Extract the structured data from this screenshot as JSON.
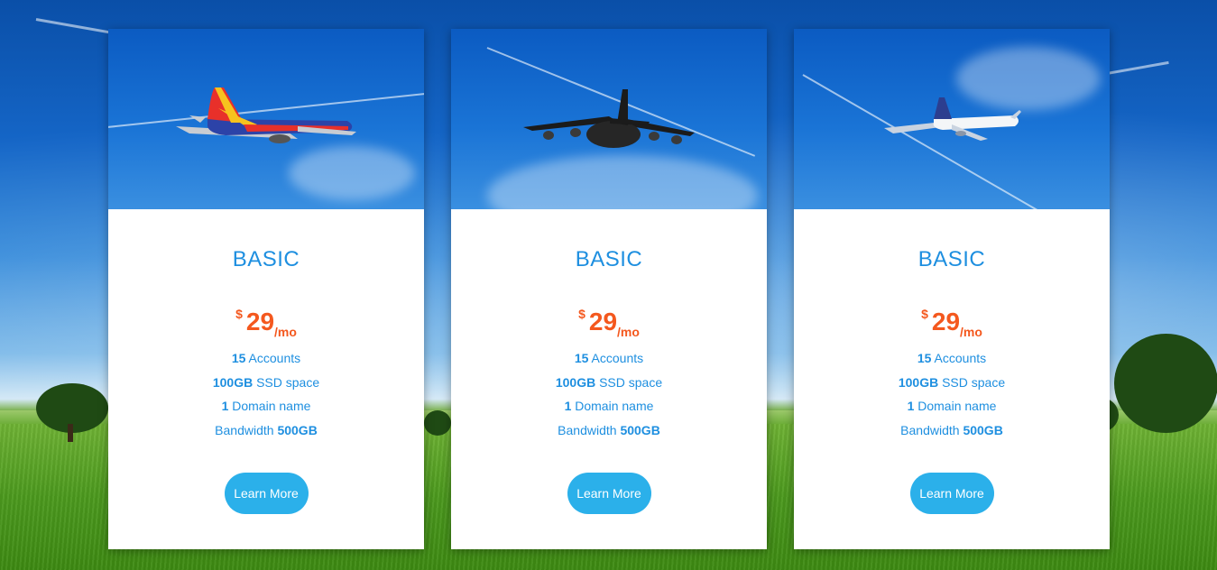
{
  "plans": [
    {
      "title": "BASIC",
      "price": {
        "currency": "$",
        "amount": "29",
        "period": "/mo"
      },
      "features": [
        {
          "strong": "15",
          "text": " Accounts",
          "order": "strong-first"
        },
        {
          "strong": "100GB",
          "text": " SSD space",
          "order": "strong-first"
        },
        {
          "strong": "1",
          "text": " Domain name",
          "order": "strong-first"
        },
        {
          "strong": "500GB",
          "text": "Bandwidth ",
          "order": "text-first"
        }
      ],
      "button": "Learn More",
      "image": "southwest-airliner-icon"
    },
    {
      "title": "BASIC",
      "price": {
        "currency": "$",
        "amount": "29",
        "period": "/mo"
      },
      "features": [
        {
          "strong": "15",
          "text": " Accounts",
          "order": "strong-first"
        },
        {
          "strong": "100GB",
          "text": " SSD space",
          "order": "strong-first"
        },
        {
          "strong": "1",
          "text": " Domain name",
          "order": "strong-first"
        },
        {
          "strong": "500GB",
          "text": "Bandwidth ",
          "order": "text-first"
        }
      ],
      "button": "Learn More",
      "image": "black-cargo-plane-icon"
    },
    {
      "title": "BASIC",
      "price": {
        "currency": "$",
        "amount": "29",
        "period": "/mo"
      },
      "features": [
        {
          "strong": "15",
          "text": " Accounts",
          "order": "strong-first"
        },
        {
          "strong": "100GB",
          "text": " SSD space",
          "order": "strong-first"
        },
        {
          "strong": "1",
          "text": " Domain name",
          "order": "strong-first"
        },
        {
          "strong": "500GB",
          "text": "Bandwidth ",
          "order": "text-first"
        }
      ],
      "button": "Learn More",
      "image": "white-airliner-icon"
    }
  ],
  "colors": {
    "title": "#1e8fe0",
    "price": "#f4581e",
    "button": "#2bb0ea",
    "feature_text": "#1e8fe0"
  }
}
